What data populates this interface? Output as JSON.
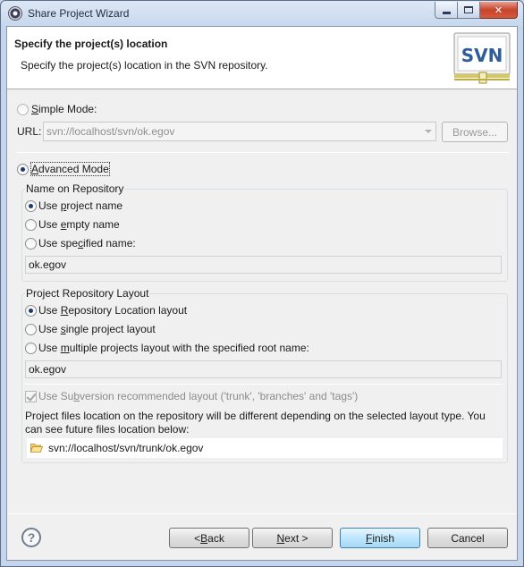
{
  "window": {
    "title": "Share Project Wizard",
    "accent_color": "#c6442c"
  },
  "header": {
    "title": "Specify the project(s) location",
    "description": "Specify the project(s) location in the SVN repository.",
    "logo_text": "SVN"
  },
  "simple_mode": {
    "label_prefix": "",
    "label_u": "S",
    "label_rest": "imple Mode:",
    "url_label": "URL:",
    "url_value": "svn://localhost/svn/ok.egov",
    "browse_label": "Browse..."
  },
  "advanced_mode": {
    "label_u": "A",
    "label_rest": "dvanced Mode"
  },
  "name_group": {
    "title": "Name on Repository",
    "opt1_pre": "Use ",
    "opt1_u": "p",
    "opt1_post": "roject name",
    "opt2_pre": "Use ",
    "opt2_u": "e",
    "opt2_post": "mpty name",
    "opt3_pre": "Use spe",
    "opt3_u": "c",
    "opt3_post": "ified name:",
    "value": "ok.egov"
  },
  "layout_group": {
    "title": "Project Repository Layout",
    "opt1_pre": "Use ",
    "opt1_u": "R",
    "opt1_post": "epository Location layout",
    "opt2_pre": "Use ",
    "opt2_u": "s",
    "opt2_post": "ingle project layout",
    "opt3_pre": "Use ",
    "opt3_u": "m",
    "opt3_post": "ultiple projects layout with the specified root name:",
    "value": "ok.egov",
    "check_pre": "Use Su",
    "check_u": "b",
    "check_post": "version recommended layout ('trunk', 'branches' and 'tags')",
    "info_line1": "Project files location on the repository will be different depending on the selected layout type. You",
    "info_line2": "can see future files location below:",
    "future_path": "svn://localhost/svn/trunk/ok.egov"
  },
  "footer": {
    "help_glyph": "?",
    "back_pre": "< ",
    "back_u": "B",
    "back_post": "ack",
    "next_u": "N",
    "next_post": "ext >",
    "finish_u": "F",
    "finish_post": "inish",
    "cancel_label": "Cancel"
  }
}
